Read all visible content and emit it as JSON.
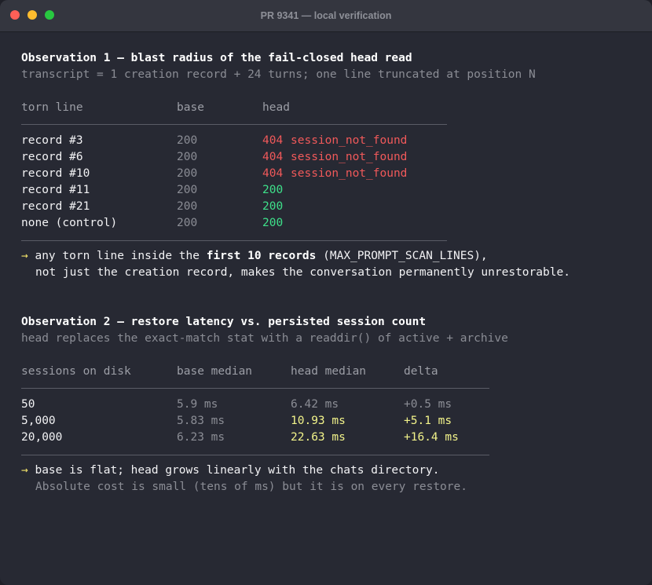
{
  "window": {
    "title": "PR 9341 — local verification"
  },
  "obs1": {
    "heading": "Observation 1 — blast radius of the fail-closed head read",
    "subheading": "transcript = 1 creation record + 24 turns; one line truncated at position N",
    "columns": [
      "torn line",
      "base",
      "head"
    ],
    "rows": [
      {
        "torn": "record #3",
        "base": "200",
        "head_code": "404",
        "head_msg": "session_not_found",
        "status": "error"
      },
      {
        "torn": "record #6",
        "base": "200",
        "head_code": "404",
        "head_msg": "session_not_found",
        "status": "error"
      },
      {
        "torn": "record #10",
        "base": "200",
        "head_code": "404",
        "head_msg": "session_not_found",
        "status": "error"
      },
      {
        "torn": "record #11",
        "base": "200",
        "head_code": "200",
        "head_msg": "",
        "status": "ok"
      },
      {
        "torn": "record #21",
        "base": "200",
        "head_code": "200",
        "head_msg": "",
        "status": "ok"
      },
      {
        "torn": "none (control)",
        "base": "200",
        "head_code": "200",
        "head_msg": "",
        "status": "ok"
      }
    ],
    "note_arrow": "→",
    "note_a": " any torn line inside the ",
    "note_b": "first 10 records",
    "note_c": " (MAX_PROMPT_SCAN_LINES),",
    "note_line2": "not just the creation record, makes the conversation permanently unrestorable."
  },
  "obs2": {
    "heading": "Observation 2 — restore latency vs. persisted session count",
    "subheading": "head replaces the exact-match stat with a readdir() of active + archive",
    "columns": [
      "sessions on disk",
      "base median",
      "head median",
      "delta"
    ],
    "rows": [
      {
        "sessions": "50",
        "base": "5.9 ms",
        "head": "6.42 ms",
        "delta": "+0.5 ms",
        "highlight": false
      },
      {
        "sessions": "5,000",
        "base": "5.83 ms",
        "head": "10.93 ms",
        "delta": "+5.1 ms",
        "highlight": true
      },
      {
        "sessions": "20,000",
        "base": "6.23 ms",
        "head": "22.63 ms",
        "delta": "+16.4 ms",
        "highlight": true
      }
    ],
    "note_arrow": "→",
    "note_line1": " base is flat; head grows linearly with the chats directory.",
    "note_line2": "Absolute cost is small (tens of ms) but it is on every restore."
  }
}
